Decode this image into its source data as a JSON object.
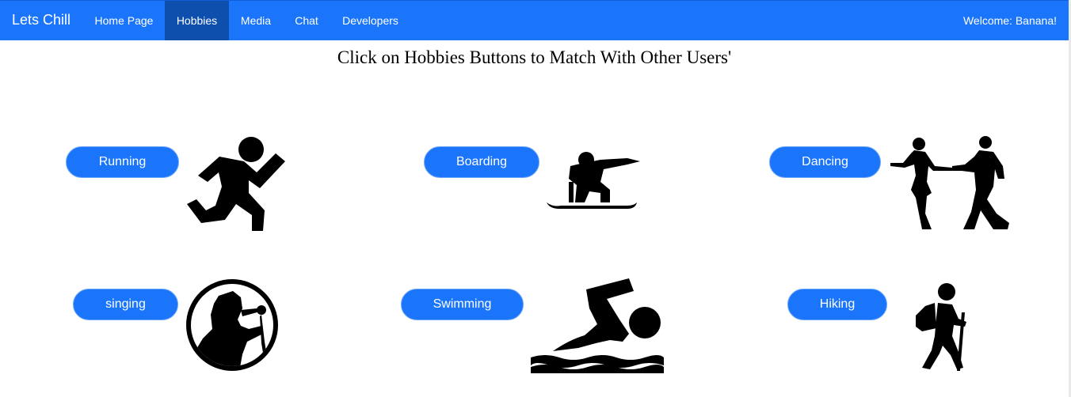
{
  "navbar": {
    "brand": "Lets Chill",
    "items": [
      {
        "label": "Home Page",
        "active": false
      },
      {
        "label": "Hobbies",
        "active": true
      },
      {
        "label": "Media",
        "active": false
      },
      {
        "label": "Chat",
        "active": false
      },
      {
        "label": "Developers",
        "active": false
      }
    ],
    "welcome": "Welcome: Banana!"
  },
  "main": {
    "headline": "Click on Hobbies Buttons to Match With Other Users'",
    "hobbies": [
      {
        "label": "Running",
        "icon": "running-icon"
      },
      {
        "label": "Boarding",
        "icon": "snowboarding-icon"
      },
      {
        "label": "Dancing",
        "icon": "dancing-couple-icon"
      },
      {
        "label": "singing",
        "icon": "singer-icon"
      },
      {
        "label": "Swimming",
        "icon": "swimmer-icon"
      },
      {
        "label": "Hiking",
        "icon": "hiker-icon"
      }
    ]
  },
  "colors": {
    "navbar": "#1b75fb",
    "nav_active": "#0e4ead",
    "button": "#1b75fb",
    "icon": "#000000"
  }
}
